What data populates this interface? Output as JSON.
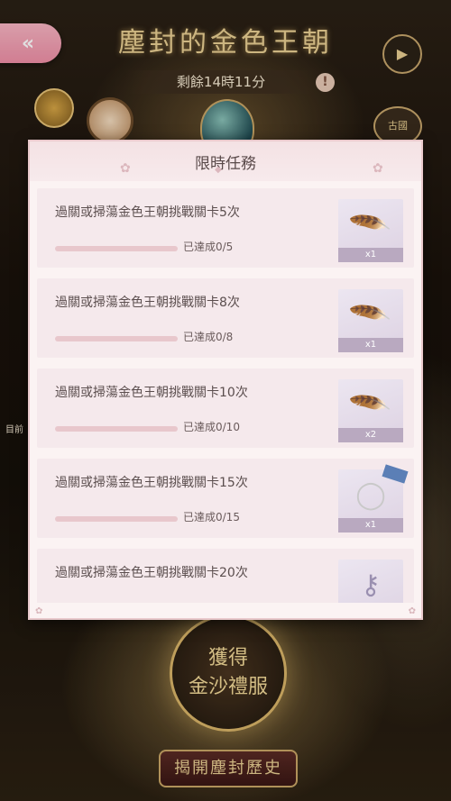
{
  "event": {
    "title": "塵封的金色王朝",
    "timer": "剩餘14時11分",
    "info_icon": "!",
    "back_icon": "«",
    "play_icon": "▶",
    "right_icon_label": "古國",
    "side_label": "目前",
    "emblem_line1": "獲得",
    "emblem_line2": "金沙禮服",
    "bottom_button": "揭開塵封歷史"
  },
  "panel": {
    "title": "限時任務",
    "tasks": [
      {
        "description": "過關或掃蕩金色王朝挑戰關卡5次",
        "progress_text": "已達成0/5",
        "progress": 0,
        "reward_icon": "feather-icon",
        "reward_qty": "x1"
      },
      {
        "description": "過關或掃蕩金色王朝挑戰關卡8次",
        "progress_text": "已達成0/8",
        "progress": 0,
        "reward_icon": "feather-icon",
        "reward_qty": "x1"
      },
      {
        "description": "過關或掃蕩金色王朝挑戰關卡10次",
        "progress_text": "已達成0/10",
        "progress": 0,
        "reward_icon": "feather-icon",
        "reward_qty": "x2"
      },
      {
        "description": "過關或掃蕩金色王朝挑戰關卡15次",
        "progress_text": "已達成0/15",
        "progress": 0,
        "reward_icon": "necklace-icon",
        "reward_qty": "x1"
      },
      {
        "description": "過關或掃蕩金色王朝挑戰關卡20次",
        "progress_text": "",
        "progress": 0,
        "reward_icon": "key-icon",
        "reward_qty": ""
      }
    ]
  },
  "colors": {
    "back_button": "#ee8fa6",
    "panel_bg": "#fbf3f3",
    "task_bg": "#f5e9ec",
    "gold": "#e9cf92"
  }
}
